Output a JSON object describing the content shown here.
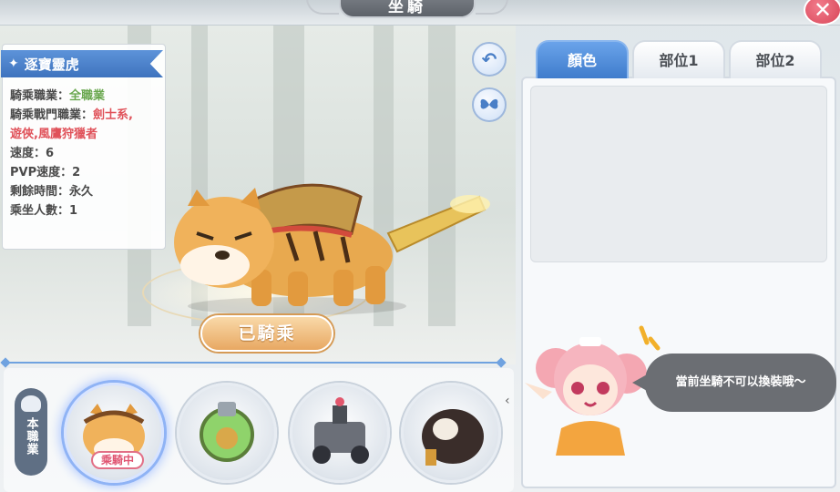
{
  "header": {
    "title": "坐騎",
    "close_label": "✕"
  },
  "mount": {
    "name": "逐寶靈虎",
    "rows": [
      {
        "label": "騎乘職業：",
        "value": "全職業",
        "tone": "green"
      },
      {
        "label": "騎乘戰門職業：",
        "value": "劍士系,",
        "tone": "red"
      },
      {
        "label": "",
        "value": "遊俠,風鷹狩獵者",
        "tone": "red"
      },
      {
        "label": "速度：",
        "value": "6",
        "tone": "normal"
      },
      {
        "label": "PVP速度：",
        "value": "2",
        "tone": "normal"
      },
      {
        "label": "剩餘時間：",
        "value": "永久",
        "tone": "normal"
      },
      {
        "label": "乘坐人數：",
        "value": "1",
        "tone": "normal"
      }
    ]
  },
  "actions": {
    "ride_status": "已騎乘"
  },
  "selector": {
    "class_tab_label": "本職業",
    "riding_badge": "乘騎中",
    "scroll_hint": "‹"
  },
  "tabs": [
    {
      "label": "顏色",
      "active": true
    },
    {
      "label": "部位1",
      "active": false
    },
    {
      "label": "部位2",
      "active": false
    }
  ],
  "npc_message": "當前坐騎不可以換裝哦～"
}
